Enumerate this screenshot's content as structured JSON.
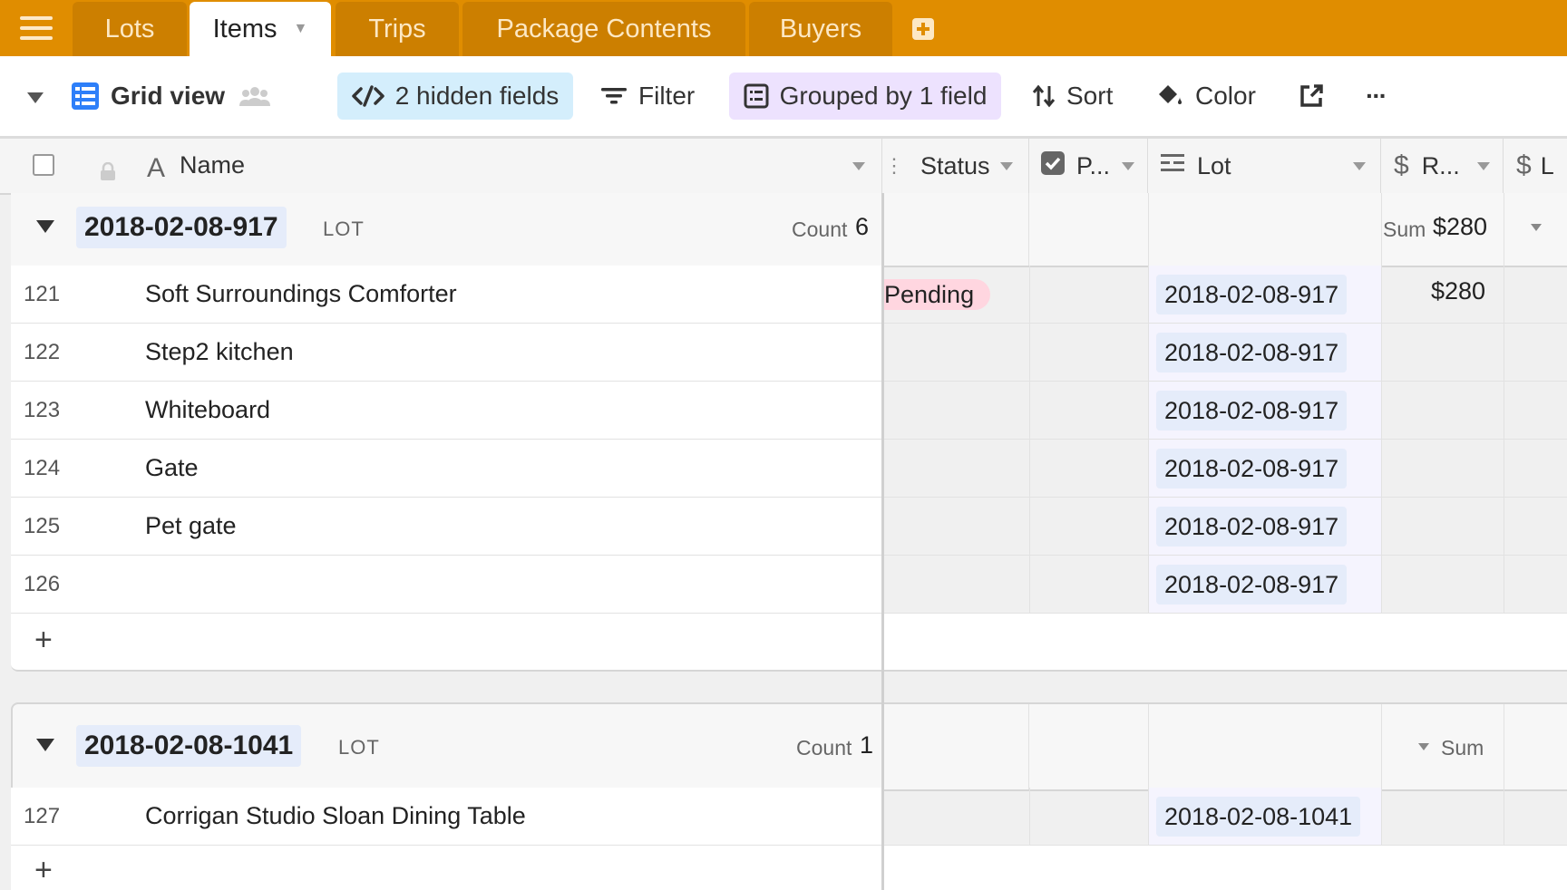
{
  "tabs": [
    {
      "label": "Lots",
      "active": false
    },
    {
      "label": "Items",
      "active": true
    },
    {
      "label": "Trips",
      "active": false
    },
    {
      "label": "Package Contents",
      "active": false
    },
    {
      "label": "Buyers",
      "active": false
    }
  ],
  "toolbar": {
    "view_name": "Grid view",
    "hidden_fields": "2 hidden fields",
    "filter": "Filter",
    "grouped": "Grouped by 1 field",
    "sort": "Sort",
    "color": "Color",
    "more": "···"
  },
  "columns": {
    "name": "Name",
    "status": "Status",
    "p": "P...",
    "lot": "Lot",
    "r": "R...",
    "l": "L"
  },
  "groups": [
    {
      "title": "2018-02-08-917",
      "field": "LOT",
      "count_label": "Count",
      "count": "6",
      "sum_label": "Sum",
      "sum": "$280",
      "rows": [
        {
          "num": "121",
          "name": "Soft Surroundings Comforter",
          "status": "Pending",
          "lot": "2018-02-08-917",
          "r": "$280"
        },
        {
          "num": "122",
          "name": "Step2 kitchen",
          "status": "",
          "lot": "2018-02-08-917",
          "r": ""
        },
        {
          "num": "123",
          "name": "Whiteboard",
          "status": "",
          "lot": "2018-02-08-917",
          "r": ""
        },
        {
          "num": "124",
          "name": "Gate",
          "status": "",
          "lot": "2018-02-08-917",
          "r": ""
        },
        {
          "num": "125",
          "name": "Pet gate",
          "status": "",
          "lot": "2018-02-08-917",
          "r": ""
        },
        {
          "num": "126",
          "name": "",
          "status": "",
          "lot": "2018-02-08-917",
          "r": ""
        }
      ]
    },
    {
      "title": "2018-02-08-1041",
      "field": "LOT",
      "count_label": "Count",
      "count": "1",
      "sum_label": "Sum",
      "rows": [
        {
          "num": "127",
          "name": "Corrigan Studio Sloan Dining Table",
          "status": "",
          "lot": "2018-02-08-1041",
          "r": ""
        }
      ]
    }
  ],
  "add_row": "+",
  "colors": {
    "tab_bar": "#e08d00",
    "status_pending": "#ffd6e0",
    "lot_chip": "#e5ecfa",
    "hidden_fields_btn": "#d4eefc",
    "grouped_btn": "#ede2fe"
  }
}
